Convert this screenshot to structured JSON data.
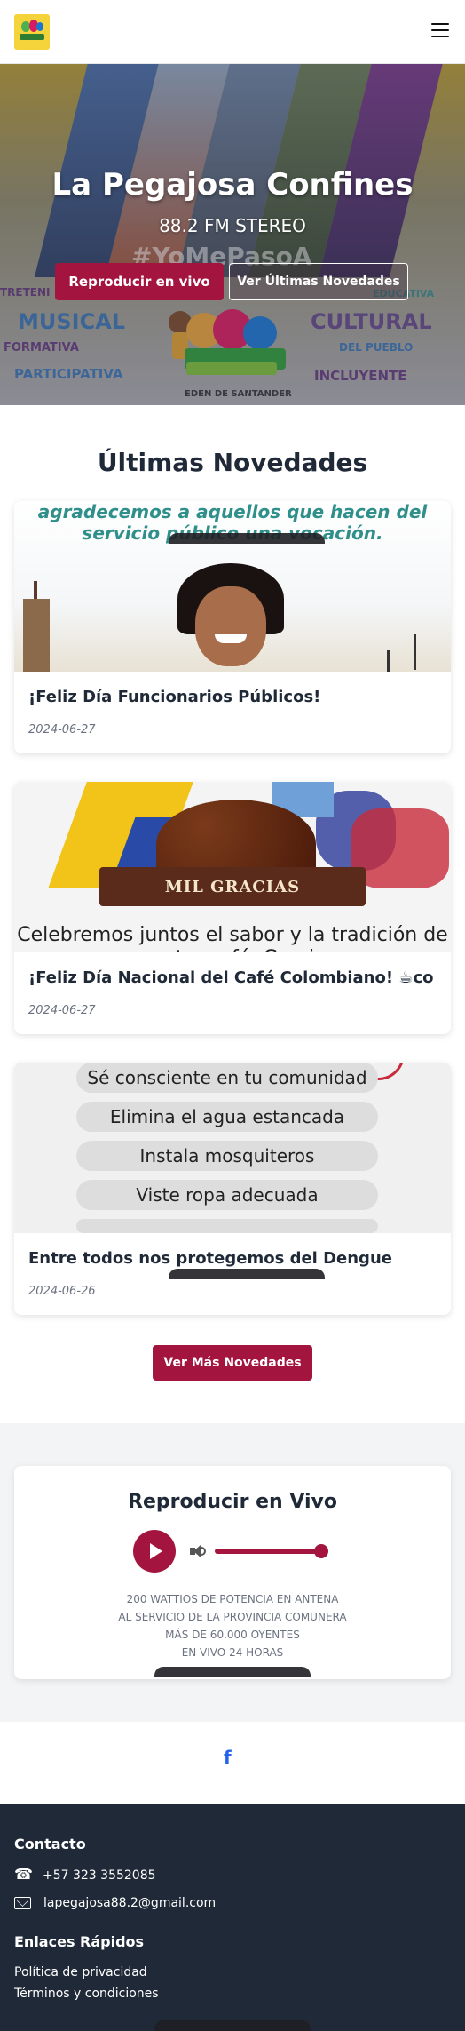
{
  "header": {
    "logo_alt": "La Pegajosa Confines logo",
    "menu_icon": "hamburger-menu-icon"
  },
  "hero": {
    "title": "La Pegajosa Confines",
    "subtitle": "88.2 FM STEREO",
    "primary_button": "Reproducir en vivo",
    "secondary_button": "Ver Últimas Novedades",
    "background_words": {
      "entretenida": "TRETENI",
      "musical": "MUSICAL",
      "informativa": "FORMATIVA",
      "participativa": "PARTICIPATIVA",
      "educativa": "EDUCATIVA",
      "cultural": "CULTURAL",
      "del_pueblo": "DEL PUEBLO",
      "incluyente": "INCLUYENTE",
      "hashtag": "#YoMePasoA",
      "eden": "EDEN DE SANTANDER"
    }
  },
  "news": {
    "section_title": "Últimas Novedades",
    "items": [
      {
        "title": "¡Feliz Día Funcionarios Públicos!",
        "date": "2024-06-27",
        "image_text": "agradecemos a aquellos que hacen del servicio público una vocación."
      },
      {
        "title": "¡Feliz Día Nacional del Café Colombiano! ☕co",
        "date": "2024-06-27",
        "image_banner": "MIL GRACIAS",
        "image_text": "Celebremos juntos el sabor y la tradición de nuestro café. Gracias"
      },
      {
        "title": "Entre todos nos protegemos del Dengue",
        "date": "2024-06-26",
        "image_items": [
          "Sé consciente en tu comunidad",
          "Elimina el agua estancada",
          "Instala mosquiteros",
          "Viste ropa adecuada"
        ]
      }
    ],
    "more_button": "Ver Más Novedades"
  },
  "player": {
    "title": "Reproducir en Vivo",
    "volume_level": 1.0,
    "info_lines": [
      "200 WATTIOS DE POTENCIA EN ANTENA",
      "AL SERVICIO DE LA PROVINCIA COMUNERA",
      "MÁS DE 60.000 OYENTES",
      "EN VIVO 24 HORAS"
    ]
  },
  "social": {
    "facebook_label": "f"
  },
  "footer": {
    "contact_heading": "Contacto",
    "phone": "+57 323 3552085",
    "email": "lapegajosa88.2@gmail.com",
    "links_heading": "Enlaces Rápidos",
    "links": [
      "Política de privacidad",
      "Términos y condiciones"
    ]
  },
  "colors": {
    "accent": "#a3153f",
    "footer_bg": "#1f2937",
    "facebook": "#2563eb"
  }
}
